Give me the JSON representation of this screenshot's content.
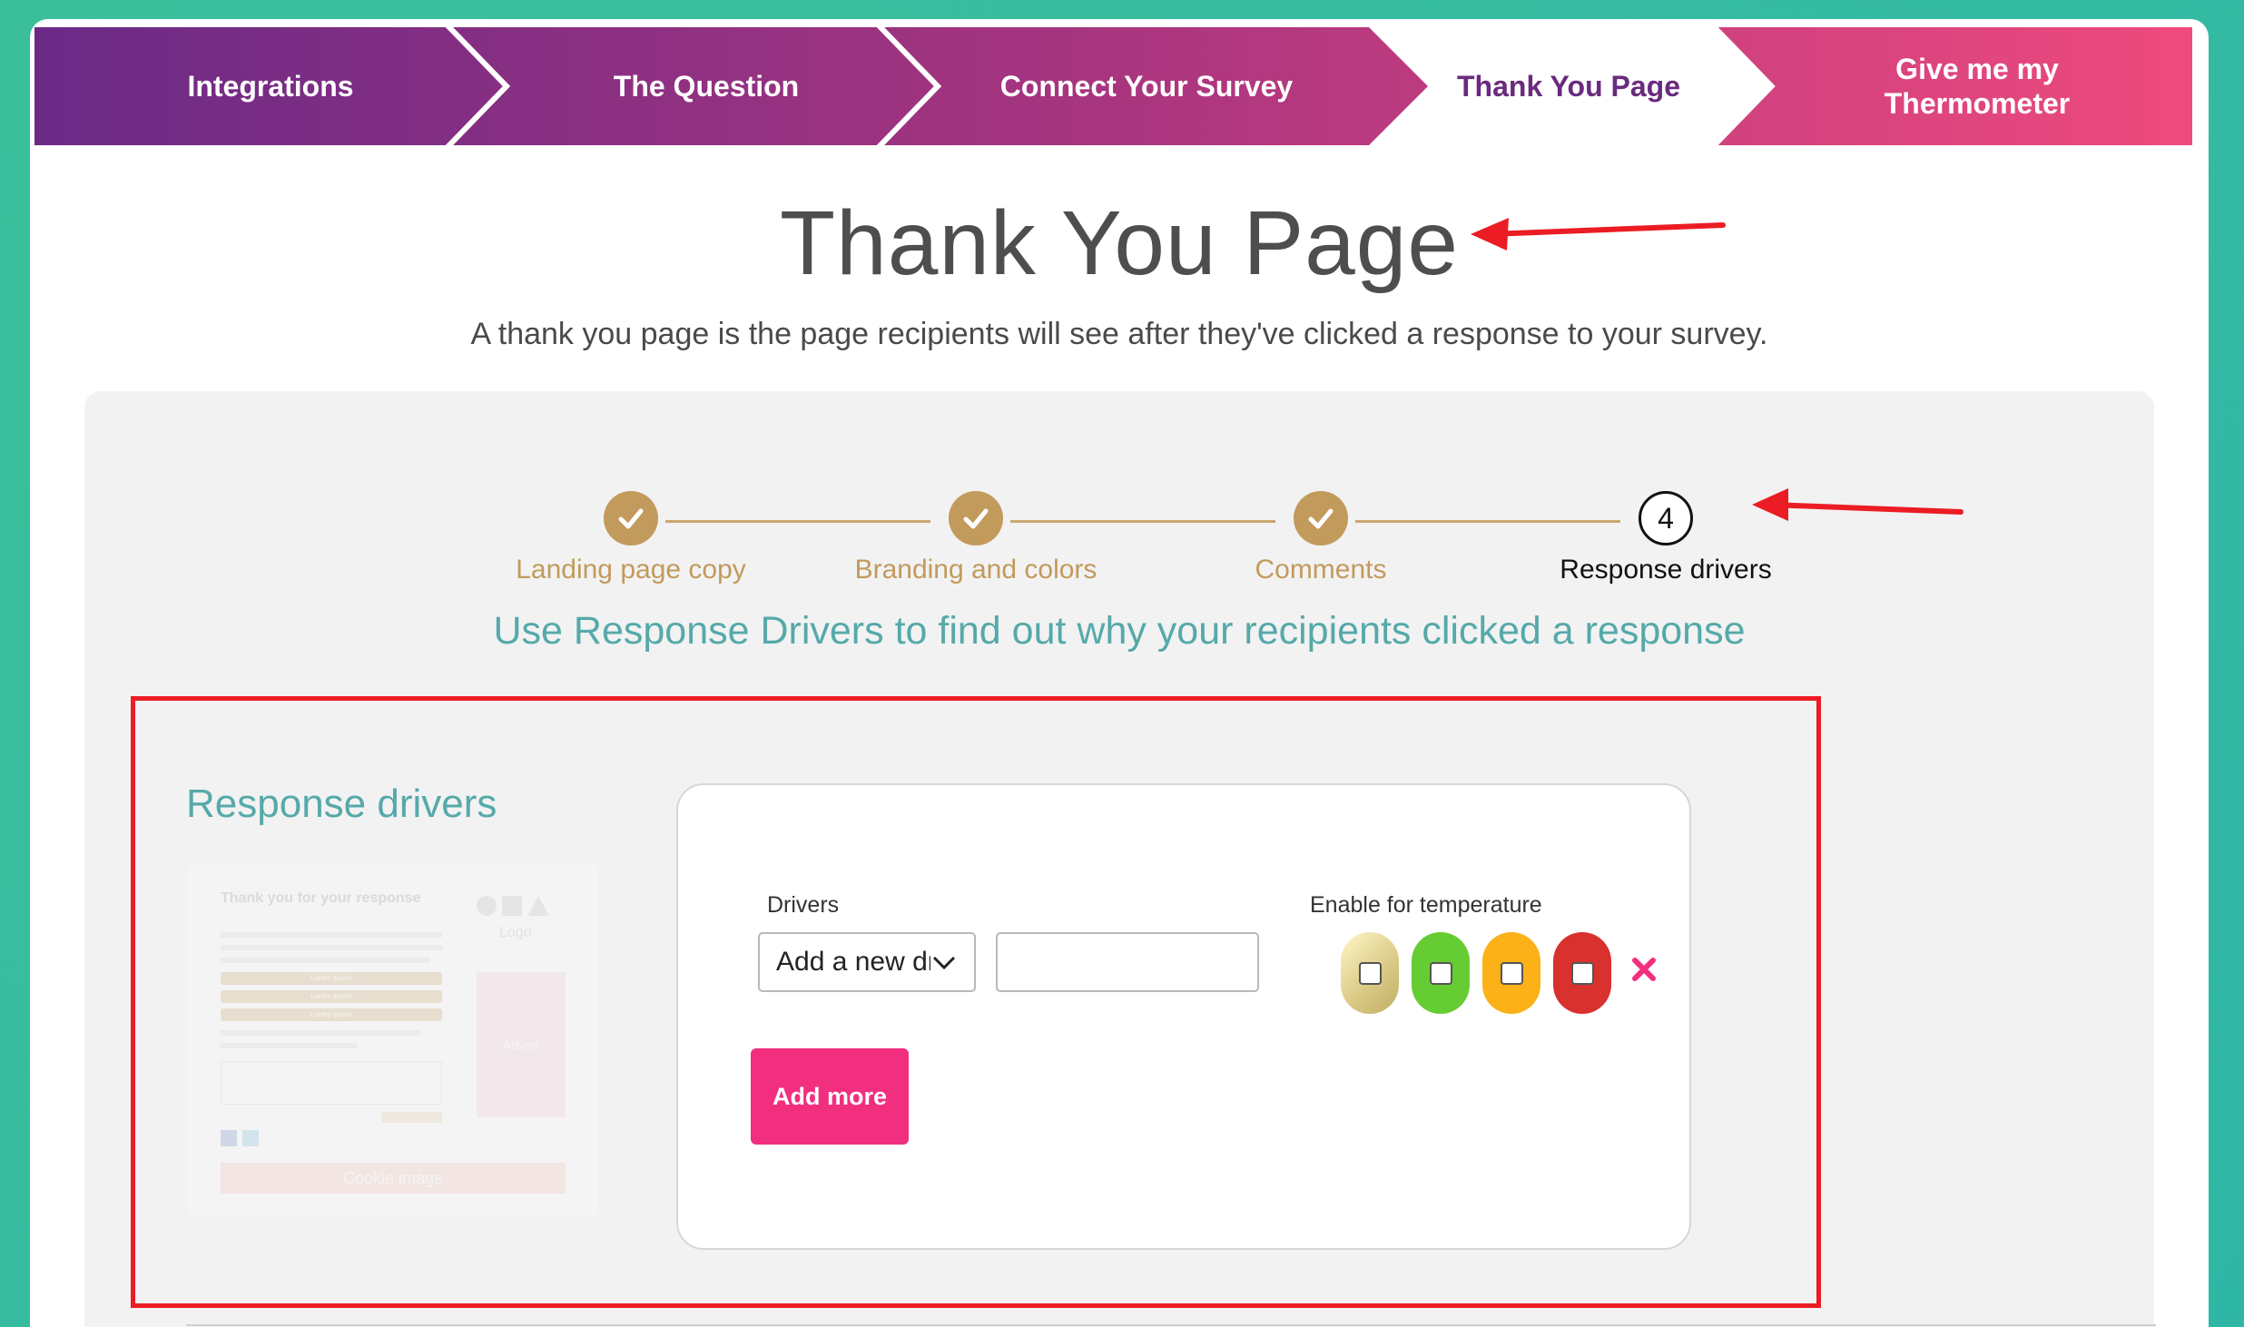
{
  "wizard": {
    "steps": [
      {
        "label": "Integrations"
      },
      {
        "label": "The Question"
      },
      {
        "label": "Connect Your Survey"
      },
      {
        "label": "Thank You Page"
      },
      {
        "label": "Give me my Thermometer"
      }
    ],
    "active_index": 3,
    "gradient_start": "#6b2a86",
    "gradient_end": "#ee4a7e"
  },
  "page": {
    "title": "Thank You Page",
    "subtitle": "A thank you page is the page recipients will see after they've clicked a response to your survey."
  },
  "progress": {
    "steps": [
      {
        "label": "Landing page copy",
        "state": "done"
      },
      {
        "label": "Branding and colors",
        "state": "done"
      },
      {
        "label": "Comments",
        "state": "done"
      },
      {
        "label": "Response drivers",
        "state": "current",
        "number": "4"
      }
    ],
    "accent_color": "#c29a5c"
  },
  "section": {
    "headline": "Use Response Drivers to find out why your recipients clicked a response",
    "title": "Response drivers"
  },
  "preview": {
    "heading": "Thank you for your response",
    "logo": "Logo",
    "bar_label": "Lorem ipsum",
    "advert": "Advert",
    "cta": "Cookie image"
  },
  "form": {
    "drivers_label": "Drivers",
    "drivers_select_value": "Add a new driver",
    "driver_text_value": "",
    "temperature_label": "Enable for temperature",
    "temperatures": [
      {
        "name": "neutral",
        "color": "#e3d99a",
        "checked": false
      },
      {
        "name": "green",
        "color": "#66cc33",
        "checked": false
      },
      {
        "name": "amber",
        "color": "#fbb117",
        "checked": false
      },
      {
        "name": "red",
        "color": "#d8312e",
        "checked": false
      }
    ],
    "remove_color": "#f22e7f",
    "add_more_label": "Add more"
  },
  "colors": {
    "teal_heading": "#56a9a9",
    "annotation_red": "#ec1c24"
  }
}
